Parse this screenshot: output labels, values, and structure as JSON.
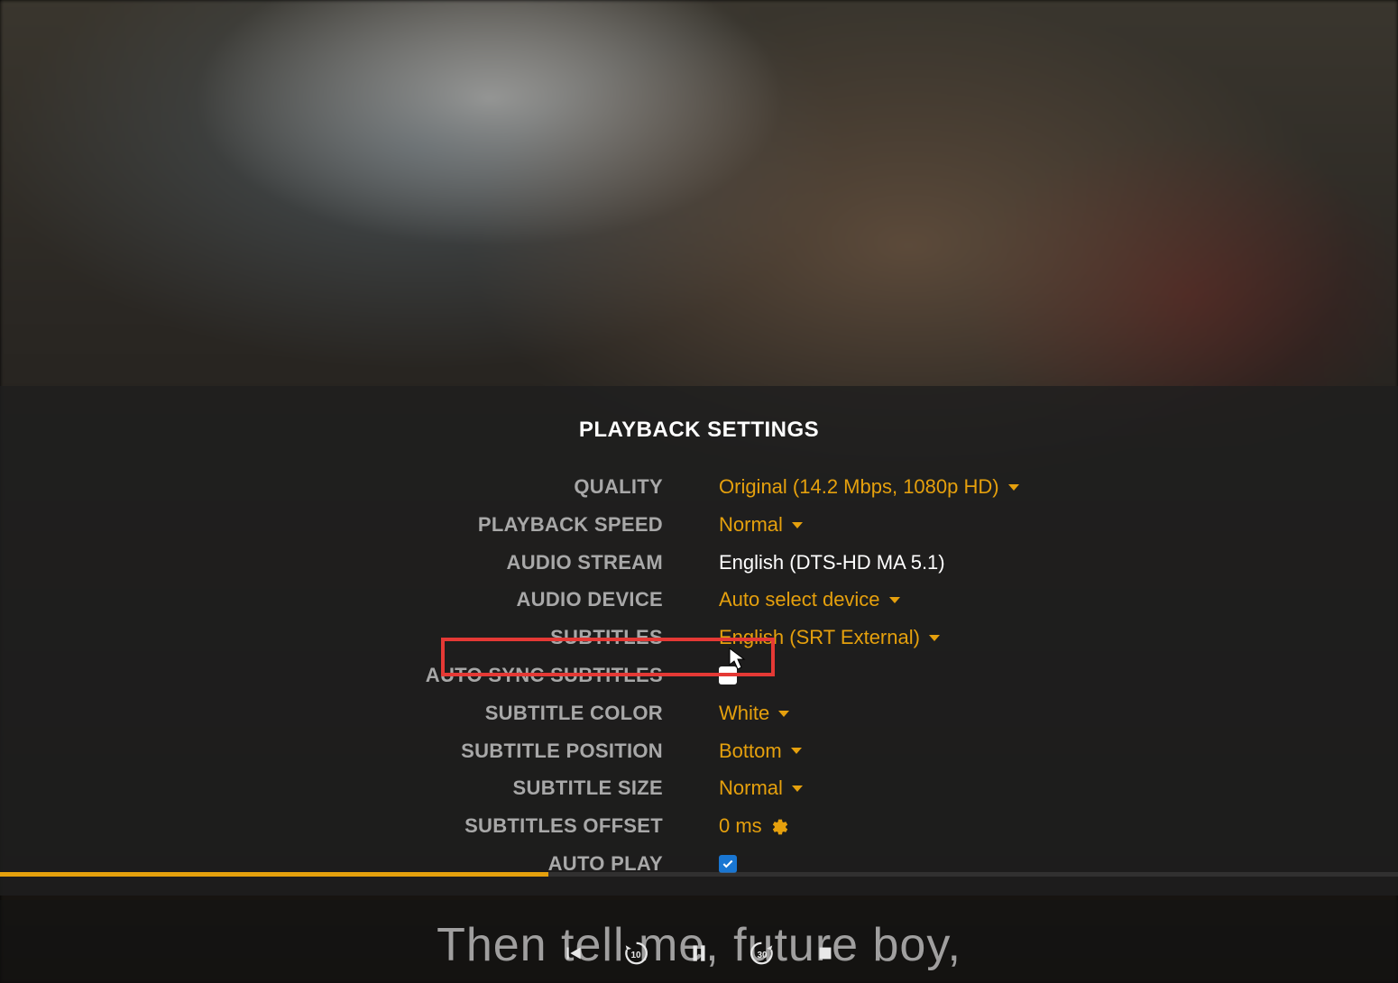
{
  "panel": {
    "title": "PLAYBACK SETTINGS"
  },
  "settings": {
    "quality": {
      "label": "QUALITY",
      "value": "Original (14.2 Mbps, 1080p HD)"
    },
    "playback_speed": {
      "label": "PLAYBACK SPEED",
      "value": "Normal"
    },
    "audio_stream": {
      "label": "AUDIO STREAM",
      "value": "English (DTS-HD MA 5.1)"
    },
    "audio_device": {
      "label": "AUDIO DEVICE",
      "value": "Auto select device"
    },
    "subtitles": {
      "label": "SUBTITLES",
      "value": "English (SRT External)"
    },
    "auto_sync_subtitles": {
      "label": "AUTO SYNC SUBTITLES",
      "checked": false
    },
    "subtitle_color": {
      "label": "SUBTITLE COLOR",
      "value": "White"
    },
    "subtitle_position": {
      "label": "SUBTITLE POSITION",
      "value": "Bottom"
    },
    "subtitle_size": {
      "label": "SUBTITLE SIZE",
      "value": "Normal"
    },
    "subtitles_offset": {
      "label": "SUBTITLES OFFSET",
      "value": "0 ms"
    },
    "auto_play": {
      "label": "AUTO PLAY",
      "checked": true
    }
  },
  "subtitle_line": "Then tell me, future boy,",
  "progress_percent": 39.2,
  "colors": {
    "accent": "#e5a00d",
    "highlight": "#e53935",
    "checkbox_checked": "#1976d2"
  }
}
